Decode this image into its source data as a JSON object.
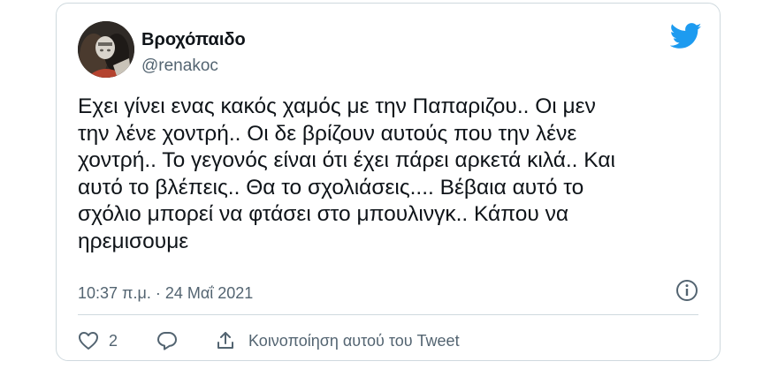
{
  "tweet": {
    "author": {
      "display_name": "Βροχόπαιδο",
      "handle": "@renakoc"
    },
    "text": "Εχει γίνει ενας κακός χαμός με την Παπαριζου.. Οι μεν\nτην  λένε χοντρή.. Οι δε βρίζουν αυτούς που την λένε\nχοντρή.. Το γεγονός είναι ότι έχει πάρει αρκετά κιλά.. Και\nαυτό το βλέπεις.. Θα το σχολιάσεις.... Βέβαια αυτό το\nσχόλιο μπορεί να φτάσει στο μπουλινγκ.. Κάπου να\nηρεμισουμε",
    "timestamp": "10:37 π.μ. · 24 Μαΐ 2021"
  },
  "actions": {
    "like_count": "2",
    "share_label": "Κοινοποίηση αυτού του Tweet"
  },
  "icons": {
    "brand": "twitter-bird-icon",
    "info": "info-icon",
    "like": "heart-icon",
    "reply": "reply-bubble-icon",
    "share": "share-icon"
  },
  "colors": {
    "brand_blue": "#1d9bf0",
    "text_primary": "#0f1419",
    "text_secondary": "#536471",
    "border": "#cfd9de"
  }
}
